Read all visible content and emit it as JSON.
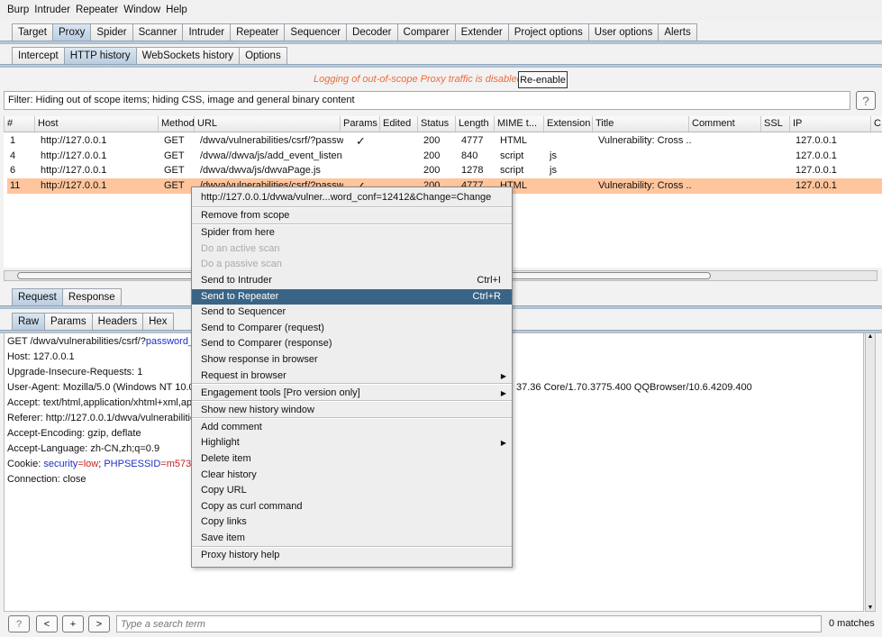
{
  "menu": [
    "Burp",
    "Intruder",
    "Repeater",
    "Window",
    "Help"
  ],
  "top_tabs": [
    "Target",
    "Proxy",
    "Spider",
    "Scanner",
    "Intruder",
    "Repeater",
    "Sequencer",
    "Decoder",
    "Comparer",
    "Extender",
    "Project options",
    "User options",
    "Alerts"
  ],
  "top_tab_active": "Proxy",
  "sub_tabs": [
    "Intercept",
    "HTTP history",
    "WebSockets history",
    "Options"
  ],
  "sub_tab_active": "HTTP history",
  "logging_notice": "Logging of out-of-scope Proxy traffic is disabled",
  "reenable_label": "Re-enable",
  "filter_text": "Filter: Hiding out of scope items;  hiding CSS, image and general binary content",
  "help_label": "?",
  "table": {
    "columns": [
      "#",
      "Host",
      "Method",
      "URL",
      "Params",
      "Edited",
      "Status",
      "Length",
      "MIME t...",
      "Extension",
      "Title",
      "Comment",
      "SSL",
      "IP",
      "C"
    ],
    "sort_indicator": "▲",
    "rows": [
      [
        "1",
        "http://127.0.0.1",
        "GET",
        "/dwva/vulnerabilities/csrf/?passw...",
        "✓",
        "",
        "200",
        "4777",
        "HTML",
        "",
        "Vulnerability: Cross ...",
        "",
        "",
        "127.0.0.1"
      ],
      [
        "4",
        "http://127.0.0.1",
        "GET",
        "/dvwa//dwva/js/add_event_listen...",
        "",
        "",
        "200",
        "840",
        "script",
        "js",
        "",
        "",
        "",
        "127.0.0.1"
      ],
      [
        "6",
        "http://127.0.0.1",
        "GET",
        "/dwva/dwva/js/dwvaPage.js",
        "",
        "",
        "200",
        "1278",
        "script",
        "js",
        "",
        "",
        "",
        "127.0.0.1"
      ],
      [
        "11",
        "http://127.0.0.1",
        "GET",
        "/dwva/vulnerabilities/csrf/?passw...",
        "✓",
        "",
        "200",
        "4777",
        "HTML",
        "",
        "Vulnerability: Cross ...",
        "",
        "",
        "127.0.0.1"
      ]
    ],
    "selected_row_color": "#ffc59d"
  },
  "req_tabs": [
    "Request",
    "Response"
  ],
  "raw_tabs": [
    "Raw",
    "Params",
    "Headers",
    "Hex"
  ],
  "request_lines": {
    "l0a": "GET /dwva/vulnerabilities/csrf/?",
    "l0b": "password_new=",
    "l1": "Host: 127.0.0.1",
    "l2": "Upgrade-Insecure-Requests: 1",
    "l3": "User-Agent: Mozilla/5.0 (Windows NT 10.0; W",
    "l3b": "37.36 Core/1.70.3775.400 QQBrowser/10.6.4209.400",
    "l4": "Accept: text/html,application/xhtml+xml,applic",
    "l5": "Referer: http://127.0.0.1/dwva/vulnerabilities/cs",
    "l6": "Accept-Encoding: gzip, deflate",
    "l7": "Accept-Language: zh-CN,zh;q=0.9",
    "l8a": "Cookie: ",
    "l8k1": "security",
    "l8v1": "=low",
    "l8s": "; ",
    "l8k2": "PHPSESSID",
    "l8v2": "=m573vqcu",
    "l9": "Connection: close"
  },
  "context_menu": {
    "header": "http://127.0.0.1/dvwa/vulner...word_conf=12412&Change=Change",
    "items": [
      {
        "label": "Remove from scope",
        "sep_before": true
      },
      {
        "label": "Spider from here",
        "sep_before": true
      },
      {
        "label": "Do an active scan",
        "disabled": true
      },
      {
        "label": "Do a passive scan",
        "disabled": true
      },
      {
        "label": "Send to Intruder",
        "shortcut": "Ctrl+I"
      },
      {
        "label": "Send to Repeater",
        "shortcut": "Ctrl+R",
        "selected": true
      },
      {
        "label": "Send to Sequencer"
      },
      {
        "label": "Send to Comparer (request)"
      },
      {
        "label": "Send to Comparer (response)"
      },
      {
        "label": "Show response in browser"
      },
      {
        "label": "Request in browser",
        "submenu": true
      },
      {
        "label": "Engagement tools [Pro version only]",
        "submenu": true,
        "sep_before": true
      },
      {
        "label": "Show new history window",
        "sep_before": true
      },
      {
        "label": "Add comment",
        "sep_before": true
      },
      {
        "label": "Highlight",
        "submenu": true
      },
      {
        "label": "Delete item"
      },
      {
        "label": "Clear history"
      },
      {
        "label": "Copy URL"
      },
      {
        "label": "Copy as curl command"
      },
      {
        "label": "Copy links"
      },
      {
        "label": "Save item"
      },
      {
        "label": "Proxy history help",
        "sep_before": true
      }
    ]
  },
  "search": {
    "help": "?",
    "prev": "<",
    "add": "+",
    "next": ">",
    "placeholder": "Type a search term",
    "matches": "0 matches"
  }
}
